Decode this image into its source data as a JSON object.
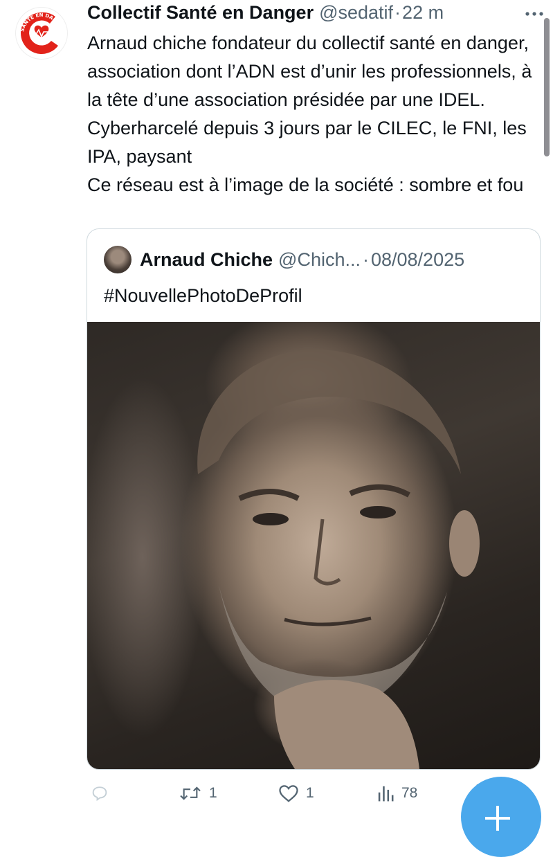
{
  "tweet": {
    "author_name": "Collectif Santé en Danger",
    "author_handle": "@sedatif",
    "separator": "·",
    "timestamp": "22 m",
    "avatar_icon": "sante-en-danger-logo",
    "avatar_logo_text": "SANTÉ EN DANGER",
    "text_lines": [
      "Arnaud chiche fondateur du collectif santé en danger, association dont l’ADN est d’unir les professionnels, à la tête d’une association présidée par une IDEL. Cyberharcelé depuis 3 jours par le CILEC, le FNI, les IPA, paysant",
      "Ce réseau est à l’image de la société : sombre et fou"
    ]
  },
  "quoted_tweet": {
    "author_name": "Arnaud Chiche",
    "author_handle": "@Chich...",
    "separator": "·",
    "date": "08/08/2025",
    "text": "#NouvellePhotoDeProfil",
    "photo_description_icon": "profile-photo"
  },
  "actions": {
    "reply_icon": "reply-icon",
    "retweet_icon": "retweet-icon",
    "retweet_count": "1",
    "like_icon": "heart-icon",
    "like_count": "1",
    "views_icon": "views-icon",
    "views_count": "78",
    "bookmark_icon": "bookmark-icon",
    "share_icon": "share-icon"
  },
  "colors": {
    "text": "#0f1419",
    "secondary": "#536471",
    "border": "#cfd9de",
    "accent": "#4aa8ec",
    "logo_red": "#e2231a"
  }
}
